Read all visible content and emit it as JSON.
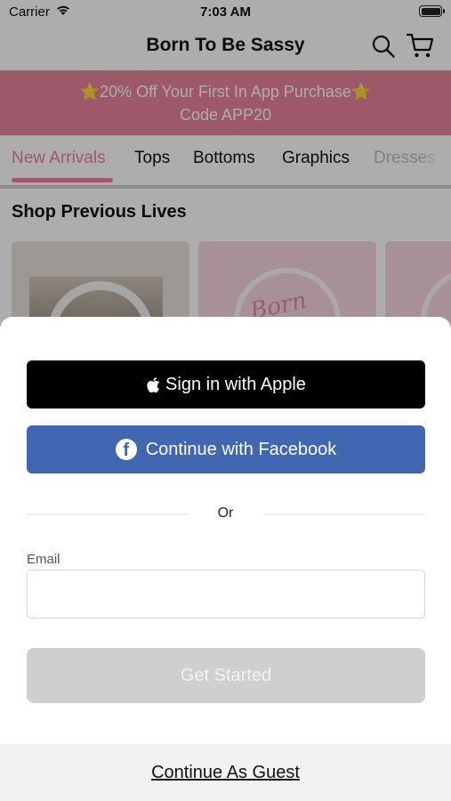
{
  "status_bar": {
    "carrier": "Carrier",
    "time": "7:03 AM"
  },
  "nav": {
    "title": "Born To Be Sassy",
    "search_icon": "search-icon",
    "cart_icon": "cart-icon"
  },
  "promo": {
    "line1_star": "⭐",
    "line1_text": "20% Off Your First In App Purchase",
    "line1_star_end": "⭐",
    "line2": "Code APP20",
    "color": "#e8849b"
  },
  "tabs": [
    {
      "label": "New Arrivals",
      "active": true
    },
    {
      "label": "Tops"
    },
    {
      "label": "Bottoms"
    },
    {
      "label": "Graphics"
    },
    {
      "label": "Dresses"
    }
  ],
  "section": {
    "title": "Shop Previous Lives"
  },
  "cards": {
    "logo_text": "Born"
  },
  "auth": {
    "apple_label": "Sign in with Apple",
    "facebook_label": "Continue with Facebook",
    "or_label": "Or",
    "email_label": "Email",
    "email_value": "",
    "get_started_label": "Get Started",
    "guest_label": "Continue As Guest"
  },
  "colors": {
    "accent": "#e8849b",
    "facebook": "#4267b2",
    "apple": "#000000",
    "disabled": "#cfcfcf"
  }
}
